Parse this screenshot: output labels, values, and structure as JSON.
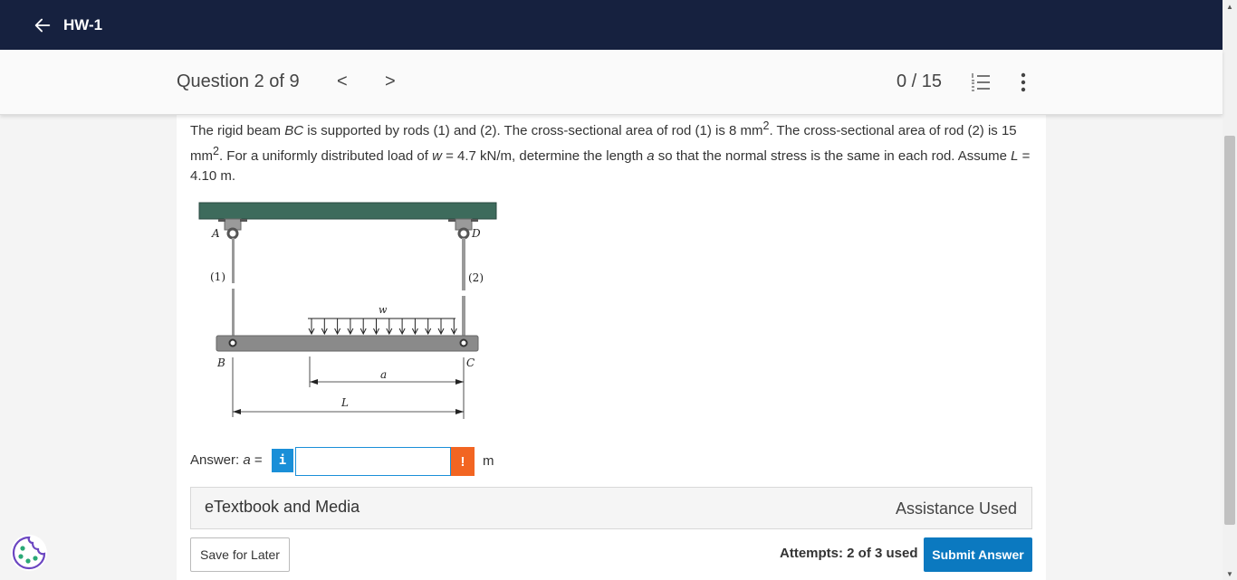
{
  "header": {
    "back_label": "HW-1"
  },
  "question_bar": {
    "title": "Question 2 of 9",
    "prev": "<",
    "next": ">",
    "score": "0 / 15",
    "list_icon": "list-icon",
    "more_icon": "more-vertical-icon"
  },
  "problem": {
    "s1": "The rigid beam ",
    "v_BC": "BC",
    "s2": " is supported by rods (1) and (2). The cross-sectional area of rod (1) is 8 mm",
    "sup1": "2",
    "s3": ". The cross-sectional area of rod (2) is 15 mm",
    "sup2": "2",
    "s4": ". For a uniformly distributed load of ",
    "v_w": "w",
    "s5": " = 4.7 kN/m, determine the length ",
    "v_a": "a",
    "s6": " so that the normal stress is the same in each rod. Assume ",
    "v_L": "L",
    "s7": " = 4.10 m."
  },
  "figure": {
    "labels": {
      "A": "A",
      "D": "D",
      "B": "B",
      "C": "C",
      "rod1": "(1)",
      "rod2": "(2)",
      "w": "w",
      "a": "a",
      "L": "L"
    },
    "colors": {
      "top_beam": "#3d6b5c",
      "rigid_beam": "#8a8a8a",
      "rod": "#999999"
    }
  },
  "answer": {
    "label_prefix": "Answer: ",
    "label_var": "a",
    "label_suffix": " =",
    "info_glyph": "i",
    "value": "",
    "warn_glyph": "!",
    "unit": "m"
  },
  "etextbook": {
    "label": "eTextbook and Media",
    "status": "Assistance Used"
  },
  "footer": {
    "save_label": "Save for Later",
    "attempts": "Attempts: 2 of 3 used",
    "submit_label": "Submit Answer"
  },
  "colors": {
    "topbar": "#16213f",
    "accent": "#1a8fd8",
    "submit": "#0b79c0",
    "warn": "#f26522"
  }
}
